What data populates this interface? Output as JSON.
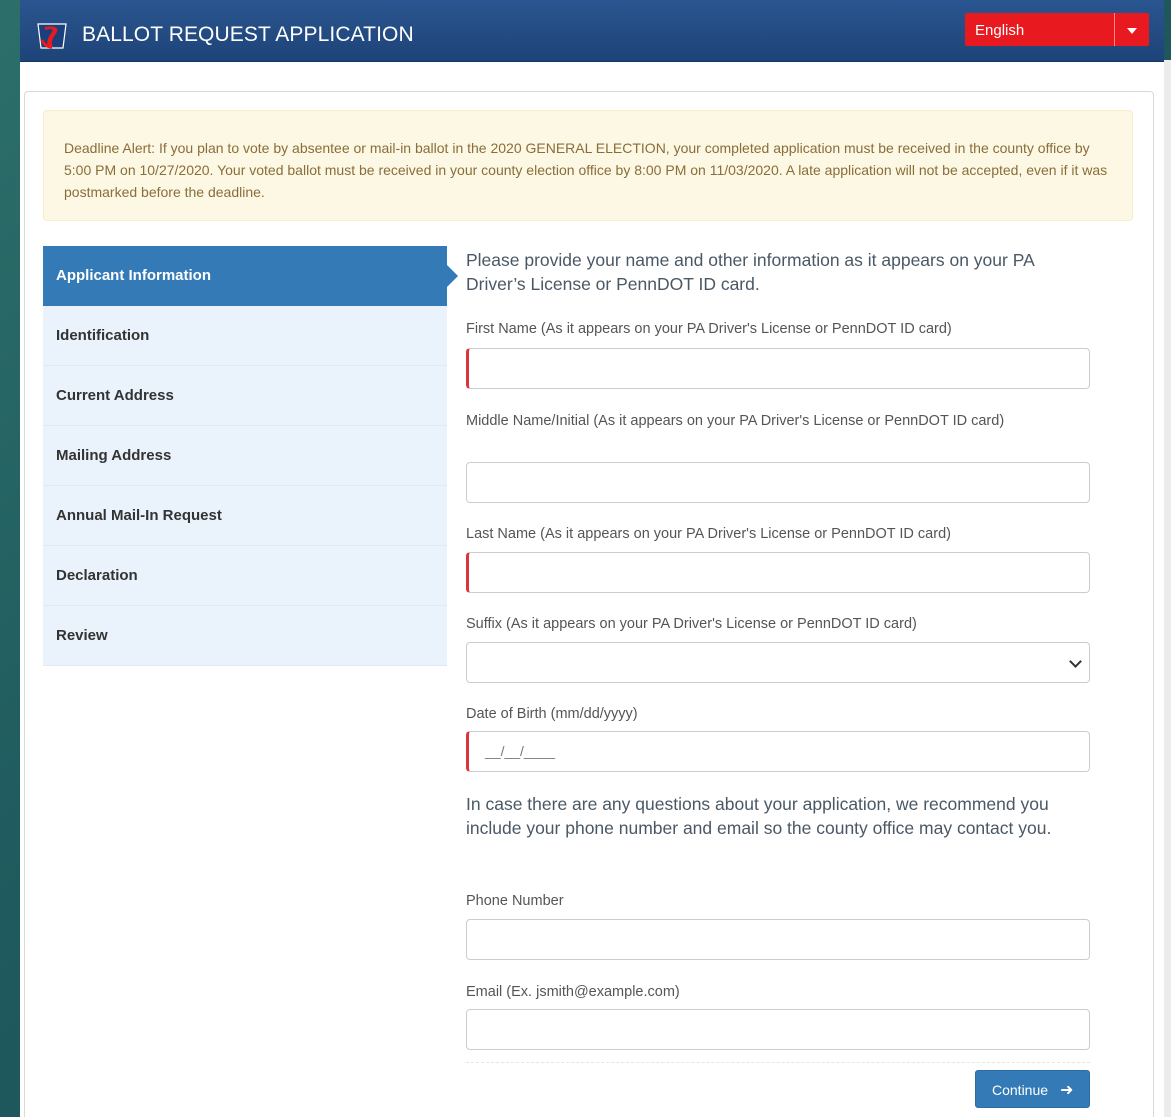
{
  "header": {
    "title": "BALLOT REQUEST APPLICATION",
    "language": "English",
    "logo_icon": "pa-keystone-logo"
  },
  "alert": {
    "text": "Deadline Alert: If you plan to vote by absentee or mail-in ballot in the 2020 GENERAL ELECTION, your completed application must be received in the county office by 5:00 PM on 10/27/2020. Your voted ballot must be received in your county election office by 8:00 PM on 11/03/2020. A late application will not be accepted, even if it was postmarked before the deadline."
  },
  "nav": {
    "items": [
      {
        "label": "Applicant Information",
        "active": true
      },
      {
        "label": "Identification"
      },
      {
        "label": "Current Address"
      },
      {
        "label": "Mailing Address"
      },
      {
        "label": "Annual Mail-In Request"
      },
      {
        "label": "Declaration"
      },
      {
        "label": "Review"
      }
    ]
  },
  "form": {
    "intro": "Please provide your name and other information as it appears on your PA Driver’s License or PennDOT ID card.",
    "first_name_label": "First Name (As it appears on your PA Driver's License or PennDOT ID card)",
    "first_name_value": "",
    "middle_name_label": "Middle Name/Initial (As it appears on your PA Driver's License or PennDOT ID card)",
    "middle_name_value": "",
    "last_name_label": "Last Name (As it appears on your PA Driver's License or PennDOT ID card)",
    "last_name_value": "",
    "suffix_label": "Suffix (As it appears on your PA Driver's License or PennDOT ID card)",
    "suffix_value": "",
    "dob_label": "Date of Birth (mm/dd/yyyy)",
    "dob_mask": "__/__/____",
    "contact_note": "In case there are any questions about your application, we recommend you include your phone number and email so the county office may contact you.",
    "phone_label": "Phone Number",
    "phone_value": "",
    "email_label": "Email (Ex. jsmith@example.com)",
    "email_value": "",
    "continue_label": "Continue",
    "continue_icon": "arrow-right-icon"
  },
  "colors": {
    "header_blue": "#234c85",
    "accent_blue": "#337ab7",
    "language_red": "#e8191f",
    "required_red": "#d9353b",
    "alert_bg": "#fcf8e3"
  }
}
